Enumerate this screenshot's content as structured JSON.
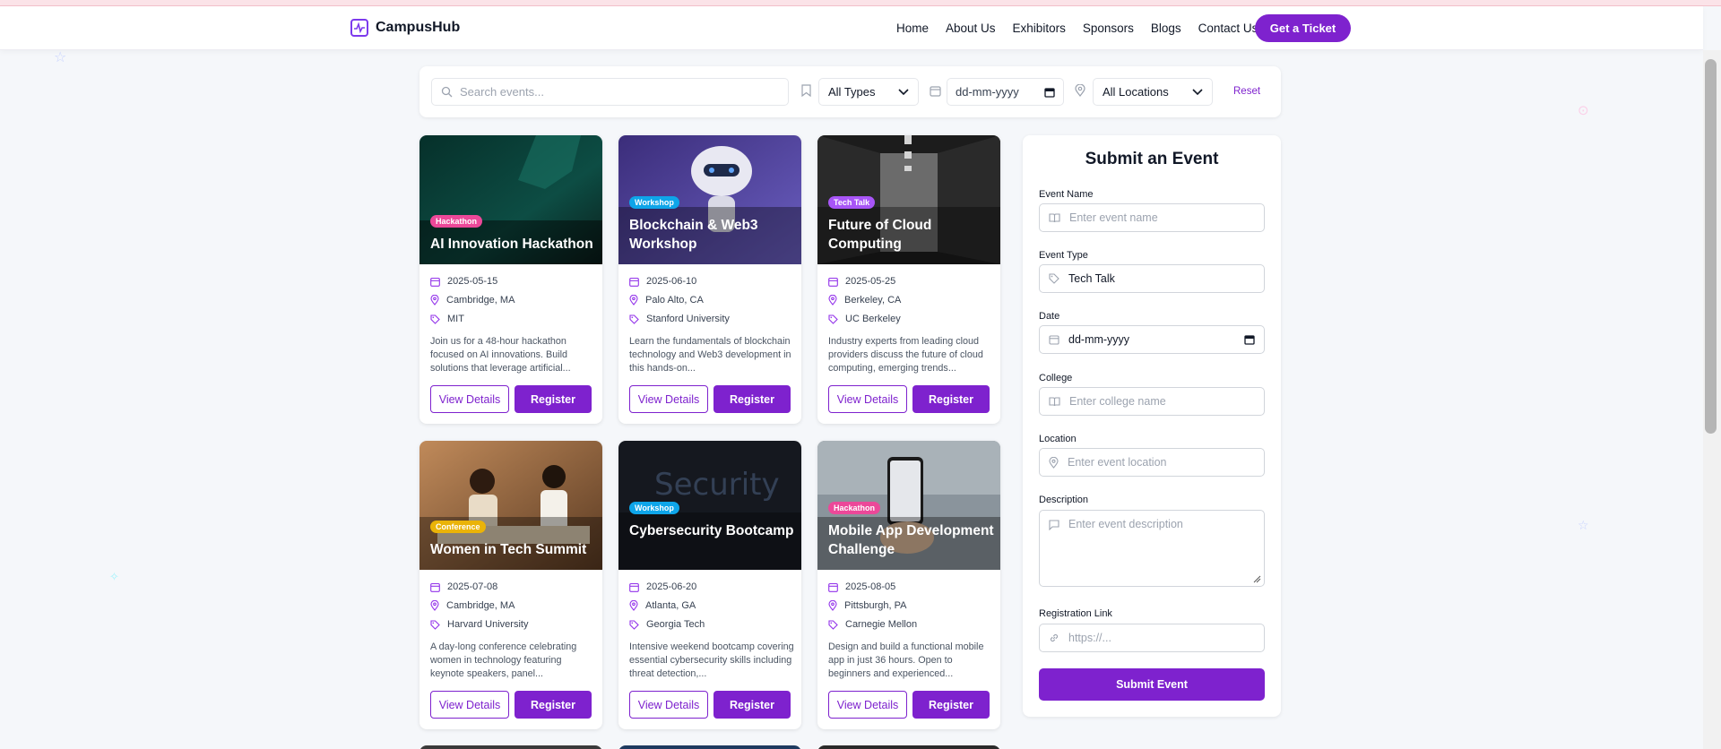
{
  "brand": {
    "name": "CampusHub"
  },
  "nav": {
    "links": [
      "Home",
      "About Us",
      "Exhibitors",
      "Sponsors",
      "Blogs",
      "Contact Us"
    ],
    "cta": "Get a Ticket"
  },
  "filters": {
    "search_placeholder": "Search events...",
    "type_selected": "All Types",
    "date_placeholder": "dd-mm-yyyy",
    "location_selected": "All Locations",
    "reset_label": "Reset"
  },
  "events": [
    {
      "badge": "Hackathon",
      "badge_color": "#ec4899",
      "title": "AI Innovation Hackathon",
      "date": "2025-05-15",
      "location": "Cambridge, MA",
      "college": "MIT",
      "description": "Join us for a 48-hour hackathon focused on AI innovations. Build solutions that leverage artificial...",
      "view_label": "View Details",
      "register_label": "Register"
    },
    {
      "badge": "Workshop",
      "badge_color": "#0ea5e9",
      "title": "Blockchain & Web3 Workshop",
      "date": "2025-06-10",
      "location": "Palo Alto, CA",
      "college": "Stanford University",
      "description": "Learn the fundamentals of blockchain technology and Web3 development in this hands-on...",
      "view_label": "View Details",
      "register_label": "Register"
    },
    {
      "badge": "Tech Talk",
      "badge_color": "#a855f7",
      "title": "Future of Cloud Computing",
      "date": "2025-05-25",
      "location": "Berkeley, CA",
      "college": "UC Berkeley",
      "description": "Industry experts from leading cloud providers discuss the future of cloud computing, emerging trends...",
      "view_label": "View Details",
      "register_label": "Register"
    },
    {
      "badge": "Conference",
      "badge_color": "#eab308",
      "title": "Women in Tech Summit",
      "date": "2025-07-08",
      "location": "Cambridge, MA",
      "college": "Harvard University",
      "description": "A day-long conference celebrating women in technology featuring keynote speakers, panel...",
      "view_label": "View Details",
      "register_label": "Register"
    },
    {
      "badge": "Workshop",
      "badge_color": "#0ea5e9",
      "title": "Cybersecurity Bootcamp",
      "date": "2025-06-20",
      "location": "Atlanta, GA",
      "college": "Georgia Tech",
      "description": "Intensive weekend bootcamp covering essential cybersecurity skills including threat detection,...",
      "view_label": "View Details",
      "register_label": "Register"
    },
    {
      "badge": "Hackathon",
      "badge_color": "#ec4899",
      "title": "Mobile App Development Challenge",
      "date": "2025-08-05",
      "location": "Pittsburgh, PA",
      "college": "Carnegie Mellon",
      "description": "Design and build a functional mobile app in just 36 hours. Open to beginners and experienced...",
      "view_label": "View Details",
      "register_label": "Register"
    }
  ],
  "submit_form": {
    "title": "Submit an Event",
    "event_name_label": "Event Name",
    "event_name_placeholder": "Enter event name",
    "event_type_label": "Event Type",
    "event_type_value": "Tech Talk",
    "date_label": "Date",
    "date_placeholder": "dd-mm-yyyy",
    "college_label": "College",
    "college_placeholder": "Enter college name",
    "location_label": "Location",
    "location_placeholder": "Enter event location",
    "description_label": "Description",
    "description_placeholder": "Enter event description",
    "reg_link_label": "Registration Link",
    "reg_link_placeholder": "https://...",
    "submit_label": "Submit Event"
  },
  "colors": {
    "accent": "#7e22ce",
    "background": "#f5f7fa"
  }
}
